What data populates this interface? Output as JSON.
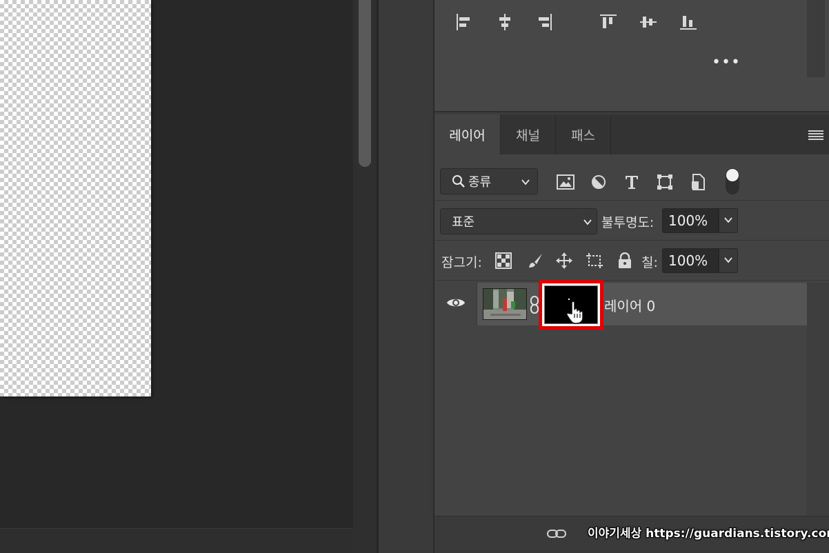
{
  "tabs": [
    {
      "label": "레이어",
      "active": true
    },
    {
      "label": "채널",
      "active": false
    },
    {
      "label": "패스",
      "active": false
    }
  ],
  "align_panel": {
    "icons": [
      "align-left-edges-icon",
      "align-horizontal-centers-icon",
      "align-right-edges-icon",
      "align-top-edges-icon",
      "align-vertical-centers-icon",
      "align-bottom-edges-icon"
    ],
    "more_label": "•••"
  },
  "filter": {
    "kind_label": "종류",
    "icons": [
      "pixel-layer-filter-icon",
      "adjustment-layer-filter-icon",
      "type-layer-filter-icon",
      "shape-layer-filter-icon",
      "smart-object-filter-icon"
    ]
  },
  "blend": {
    "mode": "표준",
    "opacity_label": "불투명도:",
    "opacity_value": "100%"
  },
  "lock": {
    "label": "잠그기:",
    "icons": [
      "lock-transparent-pixels-icon",
      "lock-image-pixels-icon",
      "lock-position-icon",
      "lock-artboard-icon",
      "lock-all-icon"
    ],
    "fill_label": "칠:",
    "fill_value": "100%"
  },
  "layer": {
    "name": "레이어 0"
  },
  "watermark": "이야기세상 https://guardians.tistory.com",
  "colors": {
    "highlight": "#e00000",
    "panel_bg": "#434343",
    "selected_row": "#555555"
  }
}
